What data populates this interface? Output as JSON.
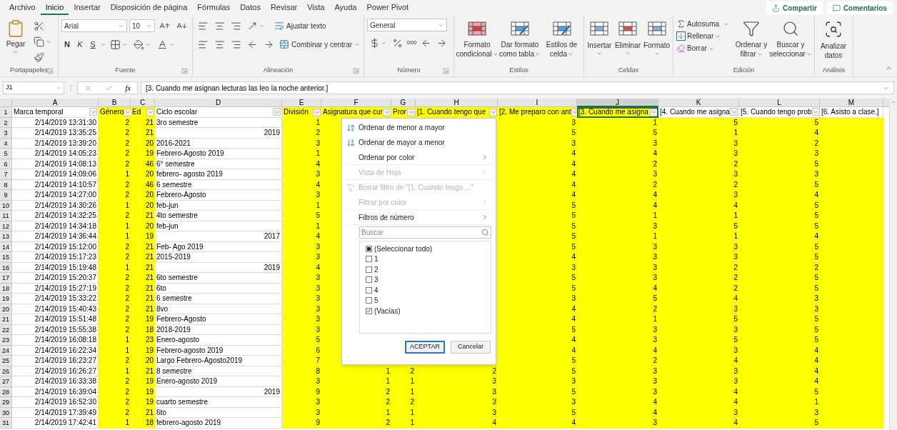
{
  "ribbon_tabs": [
    {
      "label": "Archivo",
      "selected": false
    },
    {
      "label": "Inicio",
      "selected": true
    },
    {
      "label": "Insertar",
      "selected": false
    },
    {
      "label": "Disposición de página",
      "selected": false
    },
    {
      "label": "Fórmulas",
      "selected": false
    },
    {
      "label": "Datos",
      "selected": false
    },
    {
      "label": "Revisar",
      "selected": false
    },
    {
      "label": "Vista",
      "selected": false
    },
    {
      "label": "Ayuda",
      "selected": false
    },
    {
      "label": "Power Pivot",
      "selected": false
    }
  ],
  "share_button": "Compartir",
  "comments_button": "Comentarios",
  "ribbon": {
    "clipboard": {
      "paste": "Pegar",
      "group": "Portapapeles"
    },
    "font": {
      "name": "Arial",
      "size": "10",
      "bold": "N",
      "italic": "K",
      "underline": "S",
      "group": "Fuente"
    },
    "alignment": {
      "wrap": "Ajustar texto",
      "merge": "Combinar y centrar",
      "group": "Alineación"
    },
    "number": {
      "format": "General",
      "thousands": "000",
      "group": "Número"
    },
    "styles": {
      "buttons": [
        [
          "Formato",
          "condicional"
        ],
        [
          "Dar formato",
          "como tabla"
        ],
        [
          "Estilos de",
          "celda"
        ]
      ],
      "group": "Estilos"
    },
    "cells": {
      "buttons": [
        "Insertar",
        "Eliminar",
        "Formato"
      ],
      "group": "Celdas"
    },
    "editing": {
      "autosum": "Autosuma",
      "fill": "Rellenar",
      "clear": "Borrar",
      "sort": [
        "Ordenar y",
        "filtrar"
      ],
      "find": [
        "Buscar y",
        "seleccionar"
      ],
      "group": "Edición"
    },
    "analysis": {
      "button": [
        "Analizar",
        "datos"
      ],
      "group": "Análisis"
    }
  },
  "formula_bar": {
    "name_box": "J1",
    "fx": "fx",
    "formula": "[3. Cuando me asignan lecturas las leo la noche anterior.]"
  },
  "sheet": {
    "columns": [
      {
        "letter": "A",
        "header": "Marca temporal",
        "filter": true,
        "highlighted": false,
        "header_highlighted": false,
        "selected": false
      },
      {
        "letter": "B",
        "header": "Género",
        "filter": true,
        "highlighted": true,
        "header_highlighted": true,
        "selected": false
      },
      {
        "letter": "C",
        "header": "Ed",
        "filter": true,
        "highlighted": true,
        "header_highlighted": true,
        "selected": false
      },
      {
        "letter": "D",
        "header": "Ciclo escolar",
        "filter": true,
        "highlighted": false,
        "header_highlighted": false,
        "selected": false
      },
      {
        "letter": "E",
        "header": "División",
        "filter": true,
        "highlighted": true,
        "header_highlighted": true,
        "selected": false
      },
      {
        "letter": "F",
        "header": "Asignatura que cur",
        "filter": true,
        "highlighted": true,
        "header_highlighted": true,
        "selected": false
      },
      {
        "letter": "G",
        "header": "Pror",
        "filter": true,
        "highlighted": true,
        "header_highlighted": true,
        "selected": false
      },
      {
        "letter": "H",
        "header": "[1. Cuando tengo que",
        "filter": true,
        "highlighted": true,
        "header_highlighted": true,
        "selected": false
      },
      {
        "letter": "I",
        "header": "[2. Me preparo con ant",
        "filter": true,
        "highlighted": true,
        "header_highlighted": true,
        "selected": false
      },
      {
        "letter": "J",
        "header": "[3. Cuando me asigna",
        "filter": true,
        "highlighted": true,
        "header_highlighted": true,
        "selected": true
      },
      {
        "letter": "K",
        "header": "[4. Cuando me asigna",
        "filter": true,
        "highlighted": true,
        "header_highlighted": false,
        "selected": false
      },
      {
        "letter": "L",
        "header": "[5. Cuando tengo prob",
        "filter": true,
        "highlighted": true,
        "header_highlighted": false,
        "selected": false
      },
      {
        "letter": "M",
        "header": "[6. Asisto a clase.]",
        "filter": false,
        "highlighted": true,
        "header_highlighted": false,
        "selected": false
      }
    ],
    "header_row": "1",
    "rows": [
      {
        "row": "2",
        "a": "2/14/2019 13:31:30",
        "b": "2",
        "c": "21",
        "d": {
          "text": "3ro semestre",
          "kind": "text"
        },
        "e": "1",
        "i": "3",
        "j": "1",
        "k": "5",
        "l": "5"
      },
      {
        "row": "3",
        "a": "2/14/2019 13:35:25",
        "b": "2",
        "c": "21",
        "d": {
          "text": "2019",
          "kind": "number"
        },
        "e": "2",
        "i": "5",
        "j": "5",
        "k": "1",
        "l": "4"
      },
      {
        "row": "4",
        "a": "2/14/2019 13:39:20",
        "b": "2",
        "c": "20",
        "d": {
          "text": "2016-2021",
          "kind": "text"
        },
        "e": "3",
        "i": "3",
        "j": "3",
        "k": "3",
        "l": "2"
      },
      {
        "row": "5",
        "a": "2/14/2019 14:05:23",
        "b": "2",
        "c": "19",
        "d": {
          "text": "Febrero-Agosto 2019",
          "kind": "text"
        },
        "e": "1",
        "i": "4",
        "j": "4",
        "k": "3",
        "l": "3"
      },
      {
        "row": "6",
        "a": "2/14/2019 14:08:13",
        "b": "2",
        "c": "46",
        "d": {
          "text": "6° semestre",
          "kind": "text"
        },
        "e": "4",
        "i": "4",
        "j": "2",
        "k": "2",
        "l": "5"
      },
      {
        "row": "7",
        "a": "2/14/2019 14:09:06",
        "b": "1",
        "c": "20",
        "d": {
          "text": "febrero- agosto 2019",
          "kind": "text"
        },
        "e": "3",
        "i": "4",
        "j": "3",
        "k": "3",
        "l": "3"
      },
      {
        "row": "8",
        "a": "2/14/2019 14:10:57",
        "b": "2",
        "c": "46",
        "d": {
          "text": "6 semestre",
          "kind": "text"
        },
        "e": "4",
        "i": "4",
        "j": "2",
        "k": "2",
        "l": "5"
      },
      {
        "row": "9",
        "a": "2/14/2019 14:27:00",
        "b": "2",
        "c": "20",
        "d": {
          "text": "Febrero-Agosto",
          "kind": "text"
        },
        "e": "3",
        "i": "4",
        "j": "4",
        "k": "3",
        "l": "4"
      },
      {
        "row": "10",
        "a": "2/14/2019 14:30:26",
        "b": "1",
        "c": "20",
        "d": {
          "text": "feb-jun",
          "kind": "text"
        },
        "e": "1",
        "i": "5",
        "j": "4",
        "k": "4",
        "l": "5"
      },
      {
        "row": "11",
        "a": "2/14/2019 14:32:25",
        "b": "2",
        "c": "21",
        "d": {
          "text": "4to semestre",
          "kind": "text"
        },
        "e": "5",
        "i": "5",
        "j": "1",
        "k": "1",
        "l": "5"
      },
      {
        "row": "12",
        "a": "2/14/2019 14:34:18",
        "b": "1",
        "c": "20",
        "d": {
          "text": "feb-jun",
          "kind": "text"
        },
        "e": "1",
        "i": "5",
        "j": "3",
        "k": "5",
        "l": "5"
      },
      {
        "row": "13",
        "a": "2/14/2019 14:36:44",
        "b": "1",
        "c": "19",
        "d": {
          "text": "2017",
          "kind": "number"
        },
        "e": "4",
        "i": "5",
        "j": "1",
        "k": "1",
        "l": "4"
      },
      {
        "row": "14",
        "a": "2/14/2019 15:12:00",
        "b": "2",
        "c": "21",
        "d": {
          "text": "Feb- Ago 2019",
          "kind": "text"
        },
        "e": "3",
        "i": "5",
        "j": "3",
        "k": "3",
        "l": "5"
      },
      {
        "row": "15",
        "a": "2/14/2019 15:17:23",
        "b": "2",
        "c": "21",
        "d": {
          "text": "2015-2019",
          "kind": "text"
        },
        "e": "3",
        "i": "4",
        "j": "3",
        "k": "3",
        "l": "5"
      },
      {
        "row": "16",
        "a": "2/14/2019 15:19:48",
        "b": "1",
        "c": "21",
        "d": {
          "text": "2019",
          "kind": "number"
        },
        "e": "4",
        "i": "3",
        "j": "3",
        "k": "2",
        "l": "2"
      },
      {
        "row": "17",
        "a": "2/14/2019 15:20:37",
        "b": "2",
        "c": "21",
        "d": {
          "text": "6to semestre",
          "kind": "text"
        },
        "e": "3",
        "i": "5",
        "j": "3",
        "k": "2",
        "l": "5"
      },
      {
        "row": "18",
        "a": "2/14/2019 15:27:19",
        "b": "2",
        "c": "21",
        "d": {
          "text": "6to",
          "kind": "text"
        },
        "e": "3",
        "i": "5",
        "j": "4",
        "k": "2",
        "l": "5"
      },
      {
        "row": "19",
        "a": "2/14/2019 15:33:22",
        "b": "2",
        "c": "21",
        "d": {
          "text": "6 semestre",
          "kind": "text"
        },
        "e": "3",
        "i": "3",
        "j": "5",
        "k": "4",
        "l": "3"
      },
      {
        "row": "20",
        "a": "2/14/2019 15:40:43",
        "b": "2",
        "c": "21",
        "d": {
          "text": "8vo",
          "kind": "text"
        },
        "e": "3",
        "i": "4",
        "j": "2",
        "k": "3",
        "l": "3"
      },
      {
        "row": "21",
        "a": "2/14/2019 15:51:48",
        "b": "2",
        "c": "19",
        "d": {
          "text": "Febrero-Agosto",
          "kind": "text"
        },
        "e": "3",
        "i": "4",
        "j": "1",
        "k": "5",
        "l": "5"
      },
      {
        "row": "22",
        "a": "2/14/2019 15:55:38",
        "b": "2",
        "c": "18",
        "d": {
          "text": "2018-2019",
          "kind": "text"
        },
        "e": "3",
        "i": "5",
        "j": "3",
        "k": "3",
        "l": "5"
      },
      {
        "row": "23",
        "a": "2/14/2019 16:08:18",
        "b": "1",
        "c": "23",
        "d": {
          "text": "Enero-agosto",
          "kind": "text"
        },
        "e": "5",
        "i": "4",
        "j": "3",
        "k": "5",
        "l": "5"
      },
      {
        "row": "24",
        "a": "2/14/2019 16:22:34",
        "b": "1",
        "c": "19",
        "d": {
          "text": "Febrero-agosto 2019",
          "kind": "text"
        },
        "e": "6",
        "i": "4",
        "j": "4",
        "k": "3",
        "l": "4"
      },
      {
        "row": "25",
        "a": "2/14/2019 16:23:27",
        "b": "2",
        "c": "20",
        "d": {
          "text": "Largo Febrero-Agosto2019",
          "kind": "text"
        },
        "e": "7",
        "i": "5",
        "j": "2",
        "k": "4",
        "l": "4"
      },
      {
        "row": "26",
        "a": "2/14/2019 16:26:27",
        "b": "1",
        "c": "21",
        "d": {
          "text": "8 semestre",
          "kind": "text"
        },
        "e": "8",
        "f": "1",
        "g": "2",
        "h": "2",
        "i": "5",
        "j": "3",
        "k": "3",
        "l": "4"
      },
      {
        "row": "27",
        "a": "2/14/2019 16:33:38",
        "b": "2",
        "c": "19",
        "d": {
          "text": "Enero-agosto 2019",
          "kind": "text"
        },
        "e": "3",
        "f": "1",
        "g": "1",
        "h": "3",
        "i": "3",
        "j": "3",
        "k": "3",
        "l": "4"
      },
      {
        "row": "28",
        "a": "2/14/2019 16:39:04",
        "b": "2",
        "c": "19",
        "d": {
          "text": "2019",
          "kind": "number"
        },
        "e": "9",
        "f": "2",
        "g": "1",
        "h": "3",
        "i": "5",
        "j": "3",
        "k": "4",
        "l": "5"
      },
      {
        "row": "29",
        "a": "2/14/2019 16:52:30",
        "b": "2",
        "c": "19",
        "d": {
          "text": "cuarto semestre",
          "kind": "text"
        },
        "e": "3",
        "f": "2",
        "g": "2",
        "h": "3",
        "i": "3",
        "j": "4",
        "k": "4",
        "l": "1"
      },
      {
        "row": "30",
        "a": "2/14/2019 17:39:49",
        "b": "2",
        "c": "21",
        "d": {
          "text": "6to",
          "kind": "text"
        },
        "e": "3",
        "f": "1",
        "g": "1",
        "h": "3",
        "i": "5",
        "j": "4",
        "k": "3",
        "l": "3"
      },
      {
        "row": "31",
        "a": "2/14/2019 17:42:41",
        "b": "1",
        "c": "18",
        "d": {
          "text": "febrero-agosto 2019",
          "kind": "text"
        },
        "e": "9",
        "f": "2",
        "g": "1",
        "h": "4",
        "i": "4",
        "j": "3",
        "k": "4",
        "l": "5"
      }
    ]
  },
  "filter_menu": {
    "items": [
      {
        "kind": "sort-asc",
        "label": "Ordenar de menor a mayor",
        "disabled": false
      },
      {
        "kind": "sort-desc",
        "label": "Ordenar de mayor a menor",
        "disabled": false
      },
      {
        "kind": "submenu",
        "label": "Ordenar por color",
        "disabled": false
      },
      {
        "kind": "submenu",
        "label": "Vista de Hoja",
        "disabled": true
      },
      {
        "kind": "clear",
        "label": "Borrar filtro de \"[1. Cuando tengo ...\"",
        "disabled": true
      },
      {
        "kind": "submenu",
        "label": "Filtrar por color",
        "disabled": true
      },
      {
        "kind": "submenu",
        "label": "Filtros de número",
        "disabled": false
      }
    ],
    "search_placeholder": "Buscar",
    "values": [
      {
        "label": "(Seleccionar todo)",
        "checked": false,
        "indeterminate": true
      },
      {
        "label": "1",
        "checked": false,
        "indeterminate": false
      },
      {
        "label": "2",
        "checked": false,
        "indeterminate": false
      },
      {
        "label": "3",
        "checked": false,
        "indeterminate": false
      },
      {
        "label": "4",
        "checked": false,
        "indeterminate": false
      },
      {
        "label": "5",
        "checked": false,
        "indeterminate": false
      },
      {
        "label": "(Vacías)",
        "checked": true,
        "indeterminate": false
      }
    ],
    "ok": "ACEPTAR",
    "cancel": "Cancelar"
  }
}
